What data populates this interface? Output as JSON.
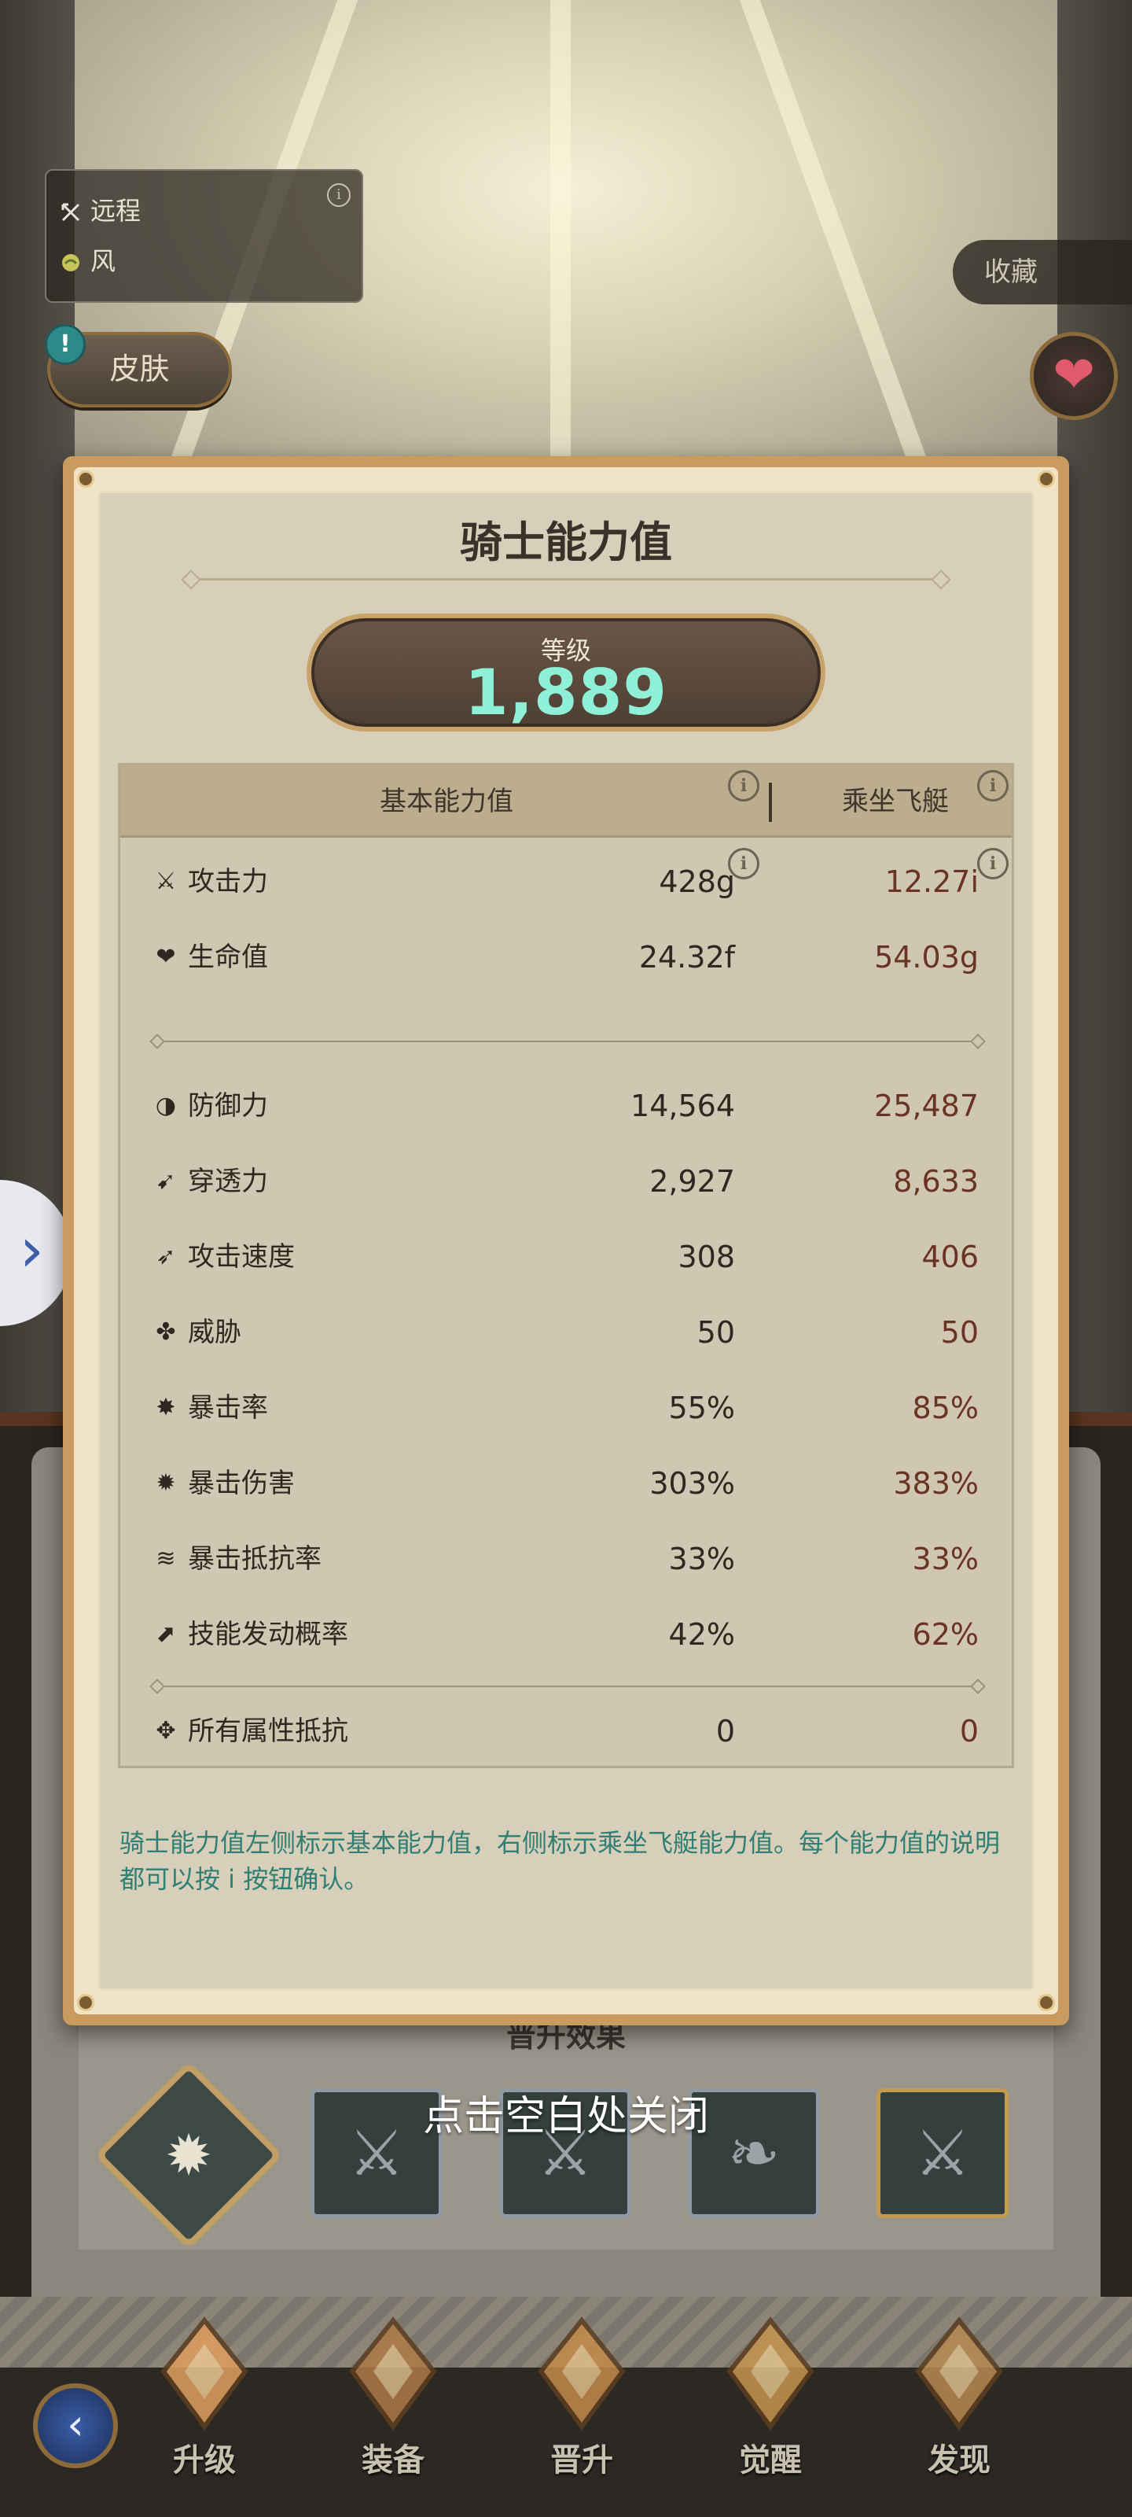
{
  "info_card": {
    "attack_type": "远程",
    "element": "风"
  },
  "skin_button": "皮肤",
  "alert_badge": "!",
  "collect_button": "收藏",
  "heart_icon": "heart-icon",
  "side_arrow": "›",
  "modal": {
    "title": "骑士能力值",
    "level_label": "等级",
    "level_value": "1,889",
    "columns": {
      "base": "基本能力值",
      "airship": "乘坐飞艇"
    },
    "info_glyph": "i",
    "rows_top": [
      {
        "icon": "sword-icon",
        "glyph": "⚔",
        "name": "攻击力",
        "base": "428g",
        "airship": "12.27i"
      },
      {
        "icon": "heart-icon",
        "glyph": "❤",
        "name": "生命值",
        "base": "24.32f",
        "airship": "54.03g"
      }
    ],
    "rows_mid": [
      {
        "icon": "shield-icon",
        "glyph": "◑",
        "name": "防御力",
        "base": "14,564",
        "airship": "25,487"
      },
      {
        "icon": "pierce-icon",
        "glyph": "➹",
        "name": "穿透力",
        "base": "2,927",
        "airship": "8,633"
      },
      {
        "icon": "speed-icon",
        "glyph": "➶",
        "name": "攻击速度",
        "base": "308",
        "airship": "406"
      },
      {
        "icon": "threat-icon",
        "glyph": "✤",
        "name": "威胁",
        "base": "50",
        "airship": "50"
      },
      {
        "icon": "crit-rate-icon",
        "glyph": "✸",
        "name": "暴击率",
        "base": "55%",
        "airship": "85%"
      },
      {
        "icon": "crit-damage-icon",
        "glyph": "✹",
        "name": "暴击伤害",
        "base": "303%",
        "airship": "383%"
      },
      {
        "icon": "crit-resist-icon",
        "glyph": "≋",
        "name": "暴击抵抗率",
        "base": "33%",
        "airship": "33%"
      },
      {
        "icon": "skill-trigger-icon",
        "glyph": "⬈",
        "name": "技能发动概率",
        "base": "42%",
        "airship": "62%"
      }
    ],
    "rows_bottom": [
      {
        "icon": "all-resist-icon",
        "glyph": "✥",
        "name": "所有属性抵抗",
        "base": "0",
        "airship": "0"
      }
    ],
    "note": "骑士能力值左侧标示基本能力值，右侧标示乘坐飞艇能力值。每个能力值的说明都可以按 i 按钮确认。"
  },
  "promote_effect_title": "晋升效果",
  "close_hint": "点击空白处关闭",
  "bottom_nav": {
    "back": "‹",
    "items": [
      {
        "label": "升级",
        "icon": "upgrade-icon",
        "color": "#e0a060"
      },
      {
        "label": "装备",
        "icon": "equipment-icon",
        "color": "#b07a46"
      },
      {
        "label": "晋升",
        "icon": "promote-icon",
        "color": "#c58a4a"
      },
      {
        "label": "觉醒",
        "icon": "awaken-icon",
        "color": "#c8944e"
      },
      {
        "label": "发现",
        "icon": "discover-icon",
        "color": "#b88a52"
      }
    ]
  },
  "colors": {
    "level_value": "#8ff0d8",
    "airship_values": "#6a3424",
    "note_text": "#2f7f73",
    "frame_gold": "#c99b5e"
  }
}
